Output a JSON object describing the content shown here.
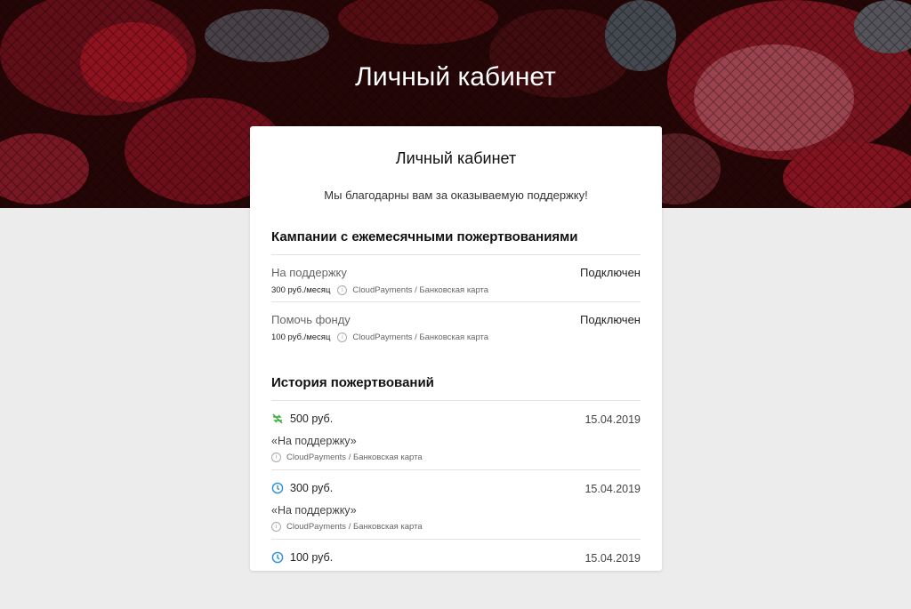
{
  "header": {
    "title": "Личный кабинет"
  },
  "card": {
    "title": "Личный кабинет",
    "subtitle": "Мы благодарны вам за оказываемую поддержку!"
  },
  "campaigns": {
    "title": "Кампании с ежемесячными пожертвованиями",
    "items": [
      {
        "name": "На поддержку",
        "status": "Подключен",
        "amount": "300 руб./месяц",
        "gateway": "CloudPayments / Банковская карта"
      },
      {
        "name": "Помочь фонду",
        "status": "Подключен",
        "amount": "100 руб./месяц",
        "gateway": "CloudPayments / Банковская карта"
      }
    ]
  },
  "history": {
    "title": "История пожертвований",
    "items": [
      {
        "amount": "500 руб.",
        "date": "15.04.2019",
        "campaign": "«На поддержку»",
        "gateway": "CloudPayments / Банковская карта",
        "icon": "recurring-cancelled-icon",
        "icon_color": "#3aab3a"
      },
      {
        "amount": "300 руб.",
        "date": "15.04.2019",
        "campaign": "«На поддержку»",
        "gateway": "CloudPayments / Банковская карта",
        "icon": "clock-icon",
        "icon_color": "#2a8fd6"
      },
      {
        "amount": "100 руб.",
        "date": "15.04.2019",
        "campaign": "",
        "gateway": "",
        "icon": "clock-icon",
        "icon_color": "#2a8fd6"
      }
    ]
  },
  "colors": {
    "hero_background": "#2a0808",
    "accent_red": "#b8192a",
    "page_background": "#ececec"
  }
}
